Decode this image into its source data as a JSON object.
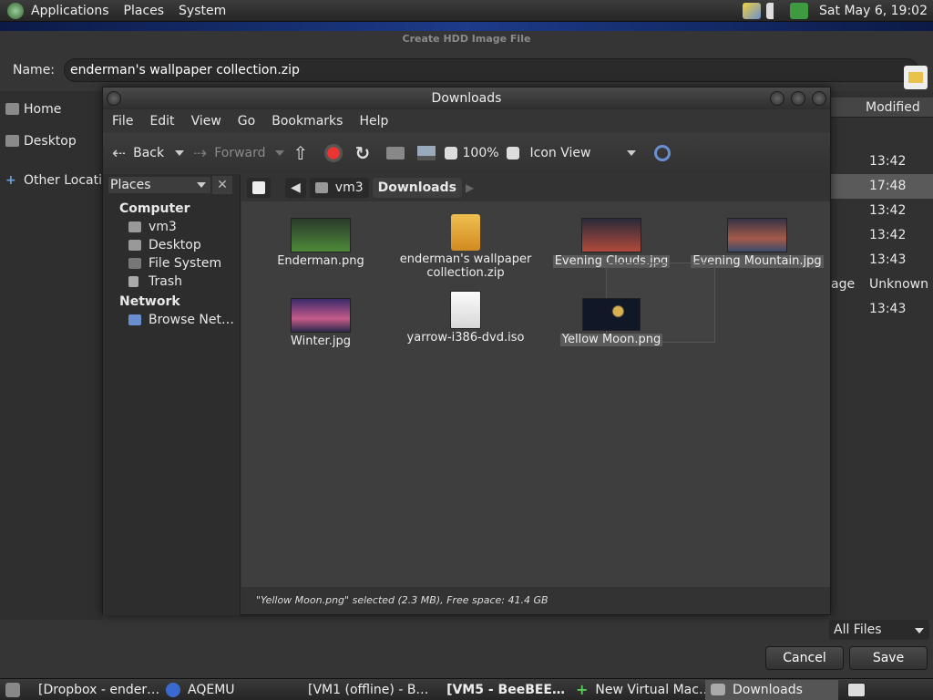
{
  "top_panel": {
    "menus": [
      "Applications",
      "Places",
      "System"
    ],
    "clock": "Sat May  6, 19:02",
    "tray_icons": [
      "bee-icon",
      "volume-icon",
      "guake-icon"
    ]
  },
  "save_dialog": {
    "title": "Create HDD Image File",
    "name_label": "Name:",
    "name_value": "enderman's wallpaper collection.zip",
    "places": [
      {
        "label": "Home",
        "icon": "home-folder-icon"
      },
      {
        "label": "Desktop",
        "icon": "folder-icon"
      },
      {
        "label": "Other Locations",
        "icon": "plus-icon"
      }
    ],
    "modified_header": "Modified",
    "modified_values": [
      "13:42",
      "17:48",
      "13:42",
      "13:42",
      "13:43",
      "Unknown",
      "13:43"
    ],
    "size_fragment": "age",
    "filter": "All Files",
    "cancel": "Cancel",
    "save": "Save"
  },
  "file_manager": {
    "title": "Downloads",
    "menus": [
      "File",
      "Edit",
      "View",
      "Go",
      "Bookmarks",
      "Help"
    ],
    "toolbar": {
      "back": "Back",
      "forward": "Forward",
      "zoom": "100%",
      "view_mode": "Icon View"
    },
    "sidebar": {
      "selector": "Places",
      "sections": [
        {
          "heading": "Computer",
          "items": [
            "vm3",
            "Desktop",
            "File System",
            "Trash"
          ]
        },
        {
          "heading": "Network",
          "items": [
            "Browse Net…"
          ]
        }
      ]
    },
    "path": [
      "vm3",
      "Downloads"
    ],
    "files": [
      {
        "name": "Enderman.png"
      },
      {
        "name": "enderman's wallpaper collection.zip",
        "line1": "enderman's wallpaper",
        "line2": "collection.zip"
      },
      {
        "name": "Evening Clouds.jpg"
      },
      {
        "name": "Evening Mountain.jpg"
      },
      {
        "name": "Winter.jpg"
      },
      {
        "name": "yarrow-i386-dvd.iso"
      },
      {
        "name": "Yellow Moon.png"
      }
    ],
    "status": "\"Yellow Moon.png\" selected (2.3 MB), Free space: 41.4 GB"
  },
  "taskbar": {
    "items": [
      {
        "label": "[Dropbox - ender…",
        "bold": false
      },
      {
        "label": "AQEMU",
        "bold": false
      },
      {
        "label": "[VM1 (offline) - B…",
        "bold": false
      },
      {
        "label": "[VM5 - BeeBEE…",
        "bold": true
      },
      {
        "label": "New Virtual Mac…",
        "bold": false
      },
      {
        "label": "Downloads",
        "bold": false
      }
    ]
  }
}
